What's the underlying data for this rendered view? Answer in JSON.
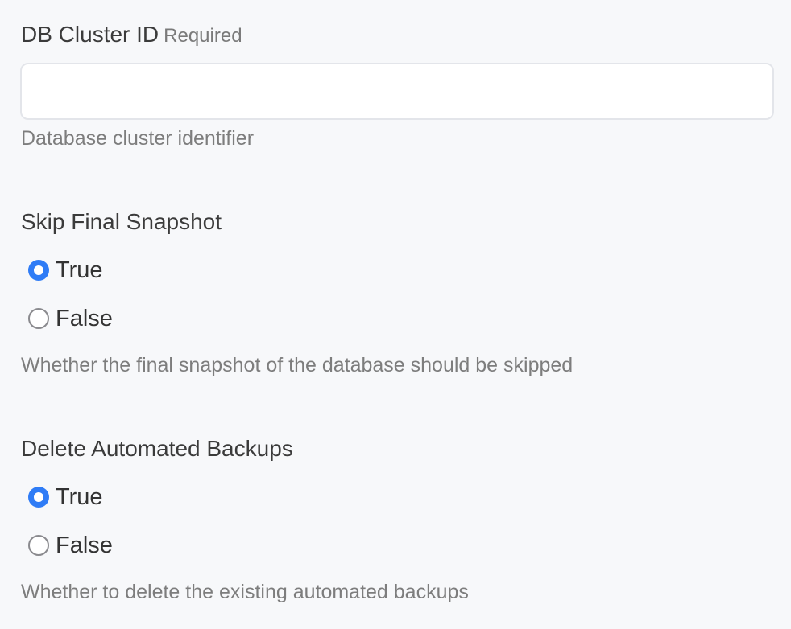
{
  "fields": {
    "cluster_id": {
      "label": "DB Cluster ID",
      "required": "Required",
      "value": "",
      "placeholder": "",
      "help": "Database cluster identifier"
    },
    "skip_final_snapshot": {
      "label": "Skip Final Snapshot",
      "selected": "True",
      "options": [
        {
          "label": "True",
          "checked": true
        },
        {
          "label": "False",
          "checked": false
        }
      ],
      "help": "Whether the final snapshot of the database should be skipped"
    },
    "delete_automated_backups": {
      "label": "Delete Automated Backups",
      "selected": "True",
      "options": [
        {
          "label": "True",
          "checked": true
        },
        {
          "label": "False",
          "checked": false
        }
      ],
      "help": "Whether to delete the existing automated backups"
    }
  },
  "colors": {
    "background": "#f7f8fa",
    "accent": "#2f7cf6",
    "label": "#3b3b3b",
    "help": "#7d7d7d",
    "input_border": "#e3e5ea"
  }
}
